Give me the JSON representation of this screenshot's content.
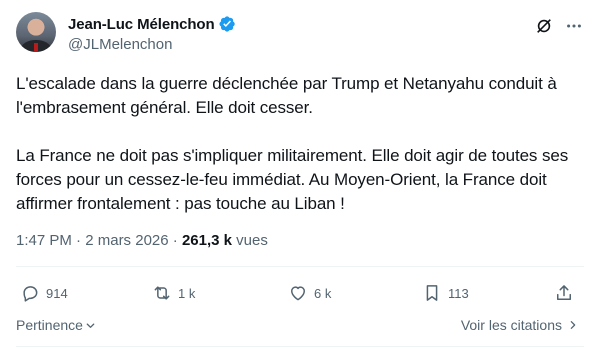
{
  "author": {
    "display_name": "Jean-Luc Mélenchon",
    "handle": "@JLMelenchon",
    "verified_icon": "verified-badge-icon"
  },
  "header_actions": [
    "grok-icon",
    "more-options-icon"
  ],
  "tweet": {
    "paragraph_1": "L'escalade dans la guerre déclenchée par Trump et Netanyahu conduit à l'embrasement général. Elle doit cesser.",
    "paragraph_2": "La France ne doit pas s'impliquer militairement. Elle doit agir de toutes ses forces pour un cessez-le-feu immédiat. Au Moyen-Orient, la France doit affirmer frontalement : pas touche au Liban !"
  },
  "meta": {
    "time": "1:47 PM",
    "separator": "·",
    "date": "2 mars 2026",
    "views_count": "261,3 k",
    "views_label": "vues"
  },
  "actions": {
    "replies": "914",
    "reposts": "1 k",
    "likes": "6 k",
    "bookmarks": "113"
  },
  "footer": {
    "relevance_label": "Pertinence",
    "quotes_label": "Voir les citations"
  },
  "colors": {
    "text_primary": "#0f1419",
    "text_secondary": "#536471",
    "verified_blue": "#1d9bf0",
    "divider": "#eff3f4"
  }
}
